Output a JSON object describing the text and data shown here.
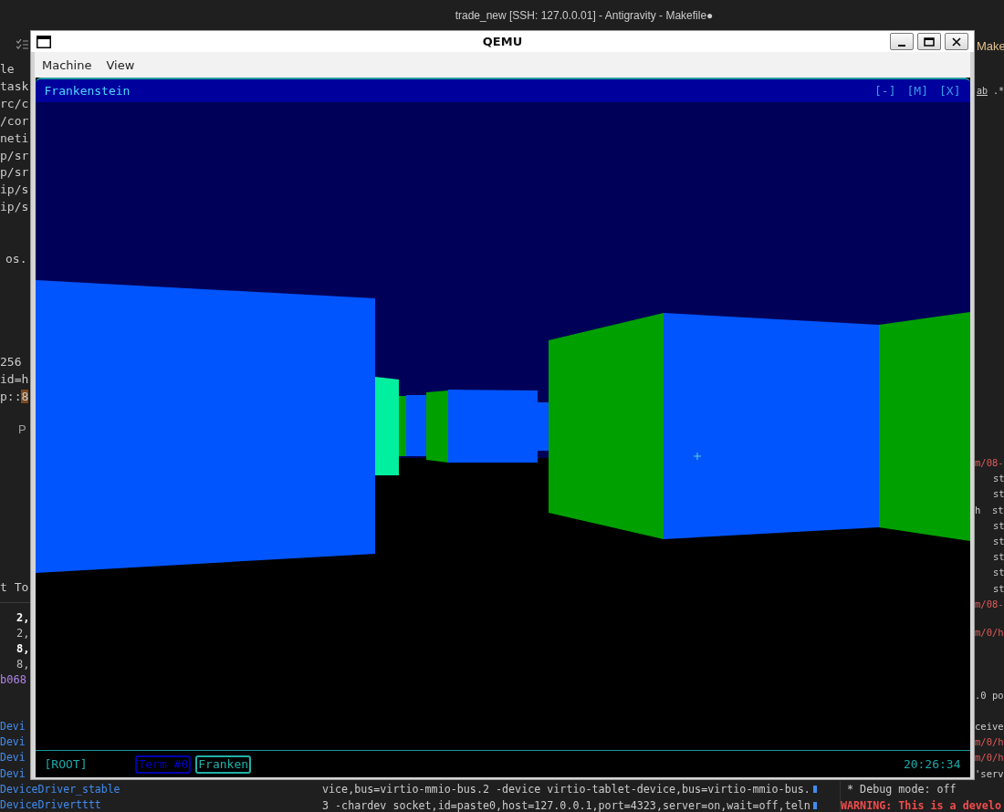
{
  "editor": {
    "title": "trade_new [SSH: 127.0.0.01] - Antigravity - Makefile●",
    "left_groups": [
      [
        {
          "text": "le",
          "kind": "plain"
        },
        {
          "text": "task",
          "kind": "plain"
        },
        {
          "text": "rc/c",
          "kind": "plain"
        },
        {
          "text": "/cor",
          "kind": "plain"
        },
        {
          "text": "neti",
          "kind": "plain"
        },
        {
          "text": "p/sr",
          "kind": "plain"
        },
        {
          "text": "p/sr",
          "kind": "plain"
        },
        {
          "text": "ip/s",
          "kind": "plain"
        },
        {
          "text": "ip/s",
          "kind": "plain"
        }
      ],
      [
        {
          "text": "os.",
          "kind": "plain"
        }
      ],
      [
        {
          "text": "256",
          "kind": "plain"
        },
        {
          "text": "id=h",
          "kind": "plain"
        },
        {
          "text": "p::",
          "kind": "plain",
          "match": "8"
        }
      ],
      [
        {
          "text": "P",
          "kind": "tab"
        }
      ],
      [
        {
          "text": "t To",
          "kind": "plain"
        }
      ],
      [
        {
          "text": "2,",
          "kind": "bold"
        },
        {
          "text": "2,",
          "kind": "number"
        },
        {
          "text": "8,",
          "kind": "bold"
        },
        {
          "text": "8,",
          "kind": "number"
        },
        {
          "text": "b068",
          "kind": "hash"
        }
      ],
      [
        {
          "text": "Devi",
          "kind": "link"
        },
        {
          "text": "Devi",
          "kind": "link"
        },
        {
          "text": "Devi",
          "kind": "link"
        },
        {
          "text": "Devi",
          "kind": "link"
        },
        {
          "text": "DeviceDriver_stable",
          "kind": "link"
        },
        {
          "text": "DeviceDrivertttt",
          "kind": "link"
        }
      ]
    ],
    "right_tab": "Make",
    "search_options": [
      "ab",
      ".*"
    ],
    "right_groups": [
      [
        {
          "text": "m/08-",
          "kind": "path"
        },
        {
          "text": "st",
          "kind": "indent"
        },
        {
          "text": "st",
          "kind": "indent"
        },
        {
          "text": "h  st",
          "kind": "plain"
        },
        {
          "text": "st",
          "kind": "indent"
        },
        {
          "text": "st",
          "kind": "indent"
        },
        {
          "text": "st",
          "kind": "indent"
        },
        {
          "text": "st",
          "kind": "indent"
        },
        {
          "text": "st",
          "kind": "indent"
        },
        {
          "text": "m/08-",
          "kind": "path"
        }
      ],
      [
        {
          "text": "m/0/h",
          "kind": "path"
        }
      ],
      [
        {
          "text": ".0 po",
          "kind": "plain"
        }
      ],
      [
        {
          "text": "ceive",
          "kind": "plain"
        },
        {
          "text": "m/0/h",
          "kind": "path"
        },
        {
          "text": "m/0/h",
          "kind": "path"
        },
        {
          "text": "'serv",
          "kind": "plain"
        }
      ]
    ],
    "terminal_lines": [
      "vice,bus=virtio-mmio-bus.2 -device virtio-tablet-device,bus=virtio-mmio-bus.",
      "3 -chardev socket,id=paste0,host=127.0.0.1,port=4323,server=on,wait=off,teln"
    ],
    "output_lines": [
      {
        "text": " * Debug mode: off",
        "kind": "plain"
      },
      {
        "text": "WARNING: This is a develo",
        "kind": "warning"
      }
    ]
  },
  "window": {
    "title": "QEMU",
    "menu": [
      "Machine",
      "View"
    ],
    "guest": {
      "title": "Frankenstein",
      "controls": [
        "[-]",
        "[M]",
        "[X]"
      ],
      "status": {
        "root": "[ROOT]",
        "tabs": [
          {
            "label": "Term #0",
            "selected": false
          },
          {
            "label": "Franken",
            "selected": true
          }
        ],
        "clock": "20:26:34"
      }
    }
  }
}
